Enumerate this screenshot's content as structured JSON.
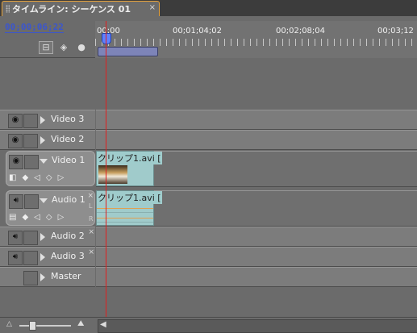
{
  "tab": {
    "title": "タイムライン: シーケンス 01",
    "close": "×"
  },
  "timecode": "00;00;06;22",
  "ruler": {
    "labels": [
      "00;00",
      "00;01;04;02",
      "00;02;08;04",
      "00;03;12"
    ]
  },
  "tracks": {
    "video3": {
      "name": "Video 3"
    },
    "video2": {
      "name": "Video 2"
    },
    "video1": {
      "name": "Video 1",
      "clip": "クリップ1.avi ["
    },
    "audio1": {
      "name": "Audio 1",
      "clip": "クリップ1.avi [",
      "L": "L",
      "R": "R"
    },
    "audio2": {
      "name": "Audio 2"
    },
    "audio3": {
      "name": "Audio 3"
    },
    "master": {
      "name": "Master"
    }
  },
  "colors": {
    "accent_tab": "#e8a33a",
    "timecode": "#3c56cc",
    "playhead": "#e02020",
    "clip": "#a0cbcb"
  }
}
